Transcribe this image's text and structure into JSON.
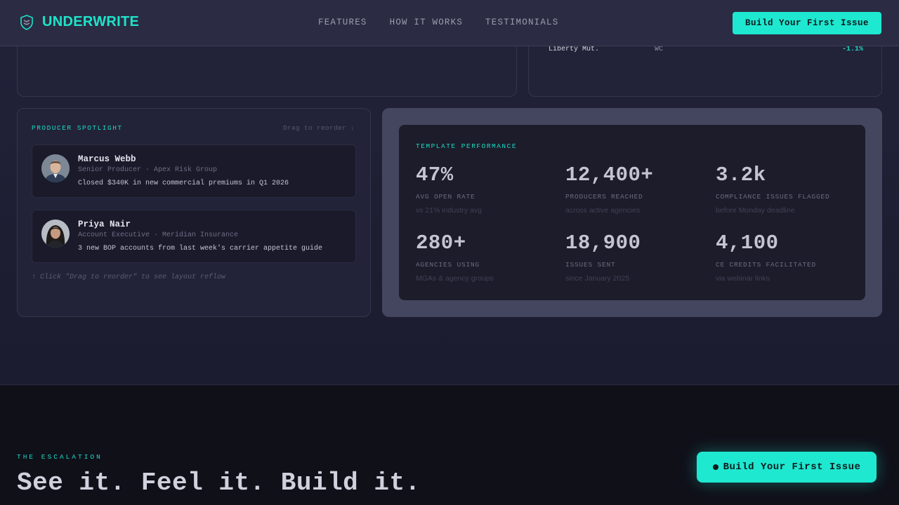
{
  "header": {
    "brand": "UNDERWRITE",
    "nav": [
      "FEATURES",
      "HOW IT WORKS",
      "TESTIMONIALS"
    ],
    "cta": "Build Your First Issue"
  },
  "carrier_table": {
    "row": {
      "carrier": "Liberty Mut.",
      "line": "WC",
      "change": "-1.1%"
    }
  },
  "spotlight": {
    "label": "PRODUCER SPOTLIGHT",
    "drag_link": "Drag to reorder ↓",
    "producers": [
      {
        "name": "Marcus Webb",
        "role": "Senior Producer · Apex Risk Group",
        "note": "Closed $340K in new commercial premiums in Q1 2026"
      },
      {
        "name": "Priya Nair",
        "role": "Account Executive · Meridian Insurance",
        "note": "3 new BOP accounts from last week's carrier appetite guide"
      }
    ],
    "hint": "↑ Click \"Drag to reorder\" to see layout reflow"
  },
  "performance": {
    "label": "TEMPLATE PERFORMANCE",
    "stats": [
      {
        "value": "47%",
        "label": "AVG OPEN RATE",
        "sub": "vs 21% industry avg"
      },
      {
        "value": "12,400+",
        "label": "PRODUCERS REACHED",
        "sub": "across active agencies"
      },
      {
        "value": "3.2k",
        "label": "COMPLIANCE ISSUES FLAGGED",
        "sub": "before Monday deadline"
      },
      {
        "value": "280+",
        "label": "AGENCIES USING",
        "sub": "MGAs & agency groups"
      },
      {
        "value": "18,900",
        "label": "ISSUES SENT",
        "sub": "since January 2025"
      },
      {
        "value": "4,100",
        "label": "CE CREDITS FACILITATED",
        "sub": "via webinar links"
      }
    ]
  },
  "escalation": {
    "label": "THE ESCALATION",
    "headline": "See it. Feel it. Build it."
  },
  "floating_cta": "Build Your First Issue",
  "colors": {
    "accent": "#1ee8d0",
    "background": "#1d1d30",
    "card": "#222338"
  },
  "icons": {
    "logo": "shield-logo-icon",
    "cta_dot": "dot-icon"
  }
}
